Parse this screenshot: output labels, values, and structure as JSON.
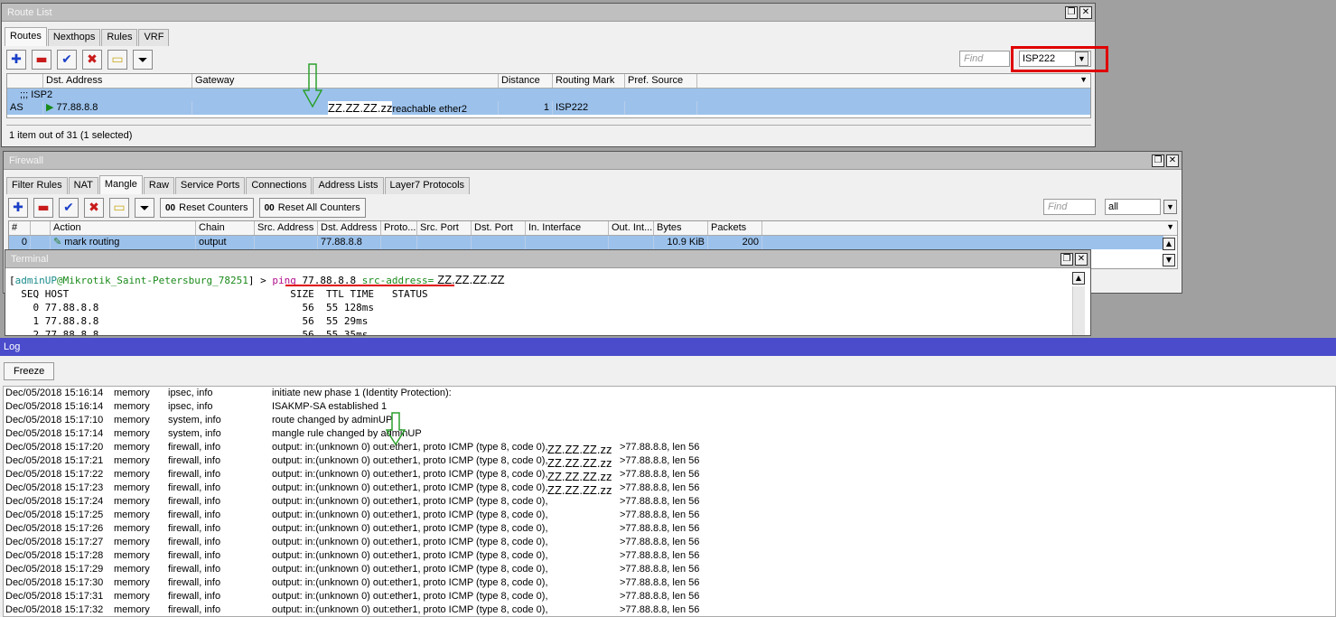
{
  "route_list": {
    "title": "Route List",
    "tabs": [
      "Routes",
      "Nexthops",
      "Rules",
      "VRF"
    ],
    "find_placeholder": "Find",
    "filter_value": "ISP222",
    "columns": [
      "Dst. Address",
      "Gateway",
      "Distance",
      "Routing Mark",
      "Pref. Source"
    ],
    "group_label": ";;; ISP2",
    "row": {
      "flags": "AS",
      "dst": "77.88.8.8",
      "gateway_masked": "ZZ.ZZ.ZZ.zz",
      "gateway_suffix": "reachable ether2",
      "distance": "1",
      "routing_mark": "ISP222"
    },
    "status": "1 item out of 31 (1 selected)"
  },
  "firewall": {
    "title": "Firewall",
    "tabs": [
      "Filter Rules",
      "NAT",
      "Mangle",
      "Raw",
      "Service Ports",
      "Connections",
      "Address Lists",
      "Layer7 Protocols"
    ],
    "reset_counters": "Reset Counters",
    "reset_all_counters": "Reset All Counters",
    "counter_glyph": "00",
    "find_placeholder": "Find",
    "filter_value": "all",
    "columns": [
      "#",
      "Action",
      "Chain",
      "Src. Address",
      "Dst. Address",
      "Proto...",
      "Src. Port",
      "Dst. Port",
      "In. Interface",
      "Out. Int...",
      "Bytes",
      "Packets"
    ],
    "row": {
      "num": "0",
      "action": "mark routing",
      "chain": "output",
      "dst": "77.88.8.8",
      "bytes": "10.9 KiB",
      "packets": "200"
    }
  },
  "terminal": {
    "title": "Terminal",
    "prompt_user": "adminUP",
    "prompt_host": "@Mikrotik_Saint-Petersburg_78251",
    "prompt_tail": "] > ",
    "prompt_open": "[",
    "cmd": "ping",
    "cmd_target": " 77.88.8.8 ",
    "cmd_arg": "src-address=",
    "cmd_masked": "ZZ.ZZ.ZZ.ZZ",
    "header": "  SEQ HOST                                     SIZE  TTL TIME   STATUS",
    "lines": [
      "    0 77.88.8.8                                  56  55 128ms",
      "    1 77.88.8.8                                  56  55 29ms",
      "    2 77.88.8.8                                  56  55 35ms"
    ]
  },
  "log": {
    "title": "Log",
    "freeze": "Freeze",
    "entries": [
      {
        "time": "Dec/05/2018 15:16:14",
        "buffer": "memory",
        "topics": "ipsec, info",
        "msg": "initiate new phase 1 (Identity Protection):",
        "src": "",
        "dst": ""
      },
      {
        "time": "Dec/05/2018 15:16:14",
        "buffer": "memory",
        "topics": "ipsec, info",
        "msg": "ISAKMP-SA established 1",
        "src": "",
        "dst": ""
      },
      {
        "time": "Dec/05/2018 15:17:10",
        "buffer": "memory",
        "topics": "system, info",
        "msg": "route changed by adminUP",
        "src": "",
        "dst": ""
      },
      {
        "time": "Dec/05/2018 15:17:14",
        "buffer": "memory",
        "topics": "system, info",
        "msg": "mangle rule changed by adminUP",
        "src": "",
        "dst": ""
      },
      {
        "time": "Dec/05/2018 15:17:20",
        "buffer": "memory",
        "topics": "firewall, info",
        "msg": "output: in:(unknown 0) out:ether1, proto ICMP (type 8, code 0),",
        "src": "ZZ.ZZ.ZZ.zz",
        "dst": ">77.88.8.8, len 56"
      },
      {
        "time": "Dec/05/2018 15:17:21",
        "buffer": "memory",
        "topics": "firewall, info",
        "msg": "output: in:(unknown 0) out:ether1, proto ICMP (type 8, code 0),",
        "src": "ZZ.ZZ.ZZ.zz",
        "dst": ">77.88.8.8, len 56"
      },
      {
        "time": "Dec/05/2018 15:17:22",
        "buffer": "memory",
        "topics": "firewall, info",
        "msg": "output: in:(unknown 0) out:ether1, proto ICMP (type 8, code 0),",
        "src": "ZZ.ZZ.ZZ.zz",
        "dst": ">77.88.8.8, len 56"
      },
      {
        "time": "Dec/05/2018 15:17:23",
        "buffer": "memory",
        "topics": "firewall, info",
        "msg": "output: in:(unknown 0) out:ether1, proto ICMP (type 8, code 0),",
        "src": "ZZ.ZZ.ZZ.zz",
        "dst": ">77.88.8.8, len 56"
      },
      {
        "time": "Dec/05/2018 15:17:24",
        "buffer": "memory",
        "topics": "firewall, info",
        "msg": "output: in:(unknown 0) out:ether1, proto ICMP (type 8, code 0),",
        "src": "",
        "dst": ">77.88.8.8, len 56"
      },
      {
        "time": "Dec/05/2018 15:17:25",
        "buffer": "memory",
        "topics": "firewall, info",
        "msg": "output: in:(unknown 0) out:ether1, proto ICMP (type 8, code 0),",
        "src": "",
        "dst": ">77.88.8.8, len 56"
      },
      {
        "time": "Dec/05/2018 15:17:26",
        "buffer": "memory",
        "topics": "firewall, info",
        "msg": "output: in:(unknown 0) out:ether1, proto ICMP (type 8, code 0),",
        "src": "",
        "dst": ">77.88.8.8, len 56"
      },
      {
        "time": "Dec/05/2018 15:17:27",
        "buffer": "memory",
        "topics": "firewall, info",
        "msg": "output: in:(unknown 0) out:ether1, proto ICMP (type 8, code 0),",
        "src": "",
        "dst": ">77.88.8.8, len 56"
      },
      {
        "time": "Dec/05/2018 15:17:28",
        "buffer": "memory",
        "topics": "firewall, info",
        "msg": "output: in:(unknown 0) out:ether1, proto ICMP (type 8, code 0),",
        "src": "",
        "dst": ">77.88.8.8, len 56"
      },
      {
        "time": "Dec/05/2018 15:17:29",
        "buffer": "memory",
        "topics": "firewall, info",
        "msg": "output: in:(unknown 0) out:ether1, proto ICMP (type 8, code 0),",
        "src": "",
        "dst": ">77.88.8.8, len 56"
      },
      {
        "time": "Dec/05/2018 15:17:30",
        "buffer": "memory",
        "topics": "firewall, info",
        "msg": "output: in:(unknown 0) out:ether1, proto ICMP (type 8, code 0),",
        "src": "",
        "dst": ">77.88.8.8, len 56"
      },
      {
        "time": "Dec/05/2018 15:17:31",
        "buffer": "memory",
        "topics": "firewall, info",
        "msg": "output: in:(unknown 0) out:ether1, proto ICMP (type 8, code 0),",
        "src": "",
        "dst": ">77.88.8.8, len 56"
      },
      {
        "time": "Dec/05/2018 15:17:32",
        "buffer": "memory",
        "topics": "firewall, info",
        "msg": "output: in:(unknown 0) out:ether1, proto ICMP (type 8, code 0),",
        "src": "",
        "dst": ">77.88.8.8, len 56"
      }
    ]
  },
  "window_buttons": {
    "restore": "❐",
    "close": "✕"
  },
  "colors": {
    "highlight_box": "#e00000",
    "underline": "#e00000",
    "arrow": "#2da02d",
    "selected_row": "#9cc2ec",
    "log_title": "#4a4ccc"
  }
}
